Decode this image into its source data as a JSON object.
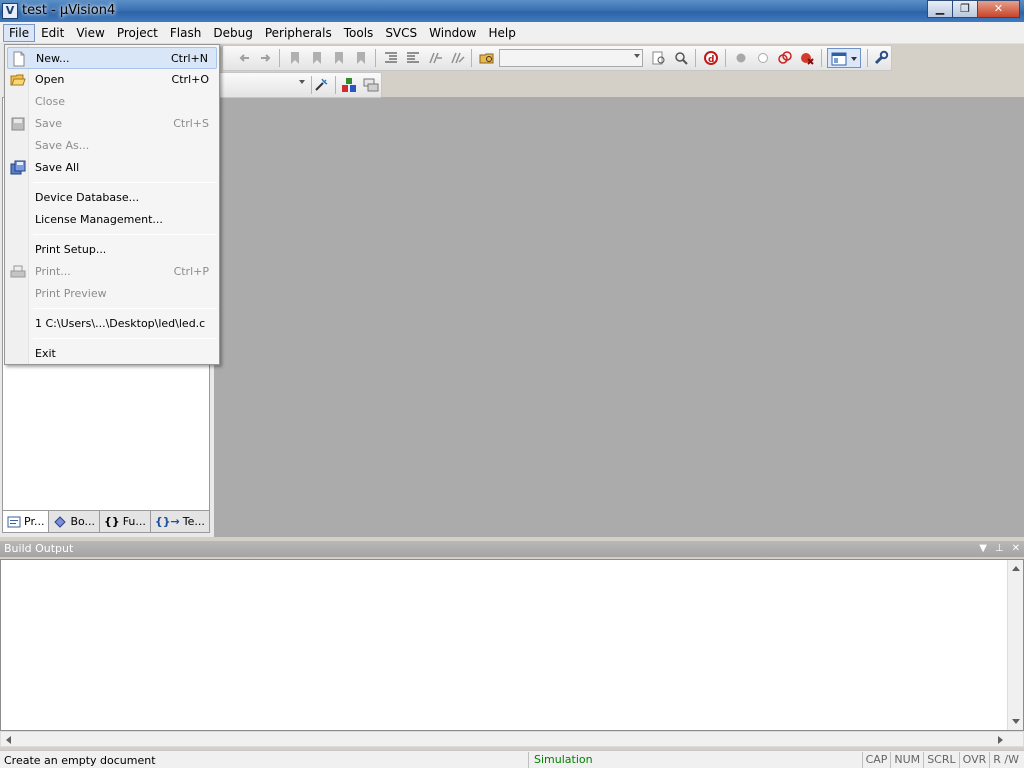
{
  "window": {
    "title": "test  - µVision4",
    "minimize": "▁",
    "maximize": "❐",
    "close": "✕"
  },
  "menubar": {
    "items": [
      "File",
      "Edit",
      "View",
      "Project",
      "Flash",
      "Debug",
      "Peripherals",
      "Tools",
      "SVCS",
      "Window",
      "Help"
    ],
    "active": "File"
  },
  "file_menu": {
    "items": [
      {
        "label": "New...",
        "shortcut": "Ctrl+N",
        "enabled": true,
        "highlighted": true,
        "icon": "new-file-icon"
      },
      {
        "label": "Open",
        "shortcut": "Ctrl+O",
        "enabled": true,
        "icon": "open-folder-icon"
      },
      {
        "label": "Close",
        "shortcut": "",
        "enabled": false
      },
      {
        "label": "Save",
        "shortcut": "Ctrl+S",
        "enabled": false,
        "icon": "save-icon"
      },
      {
        "label": "Save As...",
        "shortcut": "",
        "enabled": false
      },
      {
        "label": "Save All",
        "shortcut": "",
        "enabled": true,
        "icon": "save-all-icon"
      },
      {
        "label": "Device Database...",
        "shortcut": "",
        "enabled": true
      },
      {
        "label": "License Management...",
        "shortcut": "",
        "enabled": true
      },
      {
        "label": "Print Setup...",
        "shortcut": "",
        "enabled": true
      },
      {
        "label": "Print...",
        "shortcut": "Ctrl+P",
        "enabled": false,
        "icon": "print-icon"
      },
      {
        "label": "Print Preview",
        "shortcut": "",
        "enabled": false
      },
      {
        "label": "1 C:\\Users\\...\\Desktop\\led\\led.c",
        "shortcut": "",
        "enabled": true
      },
      {
        "label": "Exit",
        "shortcut": "",
        "enabled": true
      }
    ]
  },
  "project_tabs": [
    {
      "label": "Pr...",
      "icon": "project-icon"
    },
    {
      "label": "Bo...",
      "icon": "books-icon"
    },
    {
      "label": "Fu...",
      "icon": "functions-icon"
    },
    {
      "label": "Te...",
      "icon": "templates-icon"
    }
  ],
  "build_output": {
    "title": "Build Output",
    "content": ""
  },
  "statusbar": {
    "message": "Create an empty document",
    "mode": "Simulation",
    "keys": [
      "CAP",
      "NUM",
      "SCRL",
      "OVR",
      "R /W"
    ]
  },
  "colors": {
    "simulation_text": "#008000",
    "workspace_bg": "#ababab",
    "menu_highlight": "#d8e6f7"
  }
}
